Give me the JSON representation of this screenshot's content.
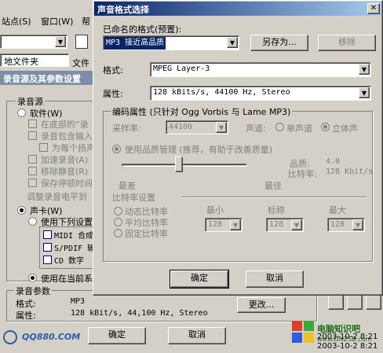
{
  "bg": {
    "menu": [
      "站点(S)",
      "窗口(W)",
      "帮"
    ],
    "local_folder": "地文件夹",
    "file_icon_label": "文件",
    "section_header": "录音源及其参数设置",
    "source_group": "录音源",
    "software_label": "软件(W)",
    "opt1": "在底部的“录",
    "opt2": "录音包含输入",
    "opt3": "为每个扬声",
    "opt4": "加速录音(A)",
    "opt5": "移除静音(R)",
    "opt6": "保存停顿时间",
    "adjust_link": "调整录音电平到",
    "soundcard_label": "声卡(W)",
    "use_following": "使用下列设置",
    "midi": "MIDI 合成",
    "spdif": "S/PDIF 输",
    "cd": "CD 数字",
    "use_current": "使用在当前系",
    "params_group": "录音参数",
    "format_label": "格式:",
    "format_value": "MP3",
    "props_label": "属性:",
    "props_value": "128 kBit/s, 44,100 Hz, Stereo",
    "change_button": "更改...",
    "ok_button": "确定",
    "cancel_button": "取消",
    "logo_text": "QQ880.COM",
    "watermark_text": "电脑知识吧",
    "watermark_url": "www.DNZSB.com",
    "time1": "2003-10-2 8:21",
    "time2": "2003-10-2 8:21"
  },
  "dialog": {
    "title": "声音格式选择",
    "named_format_label": "已命名的格式(预置):",
    "preset_value": "MP3 接近高品质",
    "save_as_button": "另存为...",
    "remove_button": "移除",
    "format_label": "格式:",
    "format_value": "MPEG Layer-3",
    "attribute_label": "属性:",
    "attribute_value": "128 kBits/s, 44100 Hz, Stereo",
    "encoding_group": "编码属性 (只针对 Ogg Vorbis 与 Lame MP3)",
    "sample_rate_label": "采样率:",
    "sample_rate_value": "44100",
    "channel_label": "声道:",
    "mono_label": "单声道",
    "stereo_label": "立体声",
    "quality_mgmt_label": "使用品质管理 (推荐，有助于改善质量)",
    "quality_label": "品质:",
    "quality_value": "4.0",
    "bitrate_label": "比特率:",
    "bitrate_value": "128 Kbit/s",
    "worst_label": "最差",
    "best_label": "最佳",
    "bitrate_settings": "比特率设置",
    "dynamic_label": "动态比特率",
    "average_label": "平均比特率",
    "fixed_label": "固定比特率",
    "min_label": "最小",
    "nominal_label": "标称",
    "max_label": "最大",
    "min_value": "128",
    "nominal_value": "128",
    "max_value": "128",
    "ok_button": "确定",
    "cancel_button": "取消",
    "quality_slider": 0.45
  }
}
